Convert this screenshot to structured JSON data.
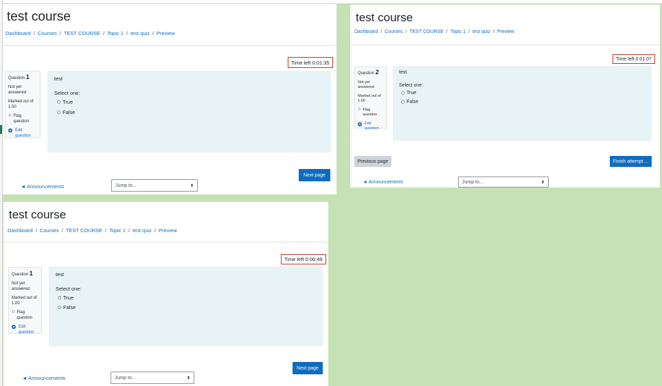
{
  "views": [
    {
      "course_title": "test course",
      "breadcrumb": [
        "Dashboard",
        "Courses",
        "TEST COURSE",
        "Topic 1",
        "test quiz",
        "Preview"
      ],
      "timer": "Time left 0:01:35",
      "question_label": "Question",
      "question_number": "1",
      "status": [
        "Not yet",
        "answered"
      ],
      "marks": [
        "Marked out of",
        "1.00"
      ],
      "flag_glyph": "⚐",
      "flag": [
        "Flag",
        "question"
      ],
      "edit": [
        "Edit",
        "question"
      ],
      "question_text": "test",
      "prompt": "Select one:",
      "options": [
        "True",
        "False"
      ],
      "next_button": "Next page",
      "announcements": "◄ Announcements",
      "jump_to": "Jump to...",
      "jump_arrows": "⬍"
    },
    {
      "course_title": "test course",
      "breadcrumb": [
        "Dashboard",
        "Courses",
        "TEST COURSE",
        "Topic 1",
        "test quiz",
        "Preview"
      ],
      "timer": "Time left 0:01:07",
      "question_label": "Question",
      "question_number": "2",
      "status": [
        "Not yet",
        "answered"
      ],
      "marks": [
        "Marked out of",
        "1.00"
      ],
      "flag_glyph": "⚐",
      "flag": [
        "Flag",
        "question"
      ],
      "edit": [
        "Edit",
        "question"
      ],
      "question_text": "test",
      "prompt": "Select one:",
      "options": [
        "True",
        "False"
      ],
      "previous_button": "Previous page",
      "finish_button": "Finish attempt ...",
      "announcements": "◄ Announcements",
      "jump_to": "Jump to...",
      "jump_arrows": "⬍"
    },
    {
      "course_title": "test course",
      "breadcrumb": [
        "Dashboard",
        "Courses",
        "TEST COURSE",
        "Topic 1",
        "test quiz",
        "Preview"
      ],
      "timer": "Time left 0:00:49",
      "question_label": "Question",
      "question_number": "1",
      "status": [
        "Not yet",
        "answered"
      ],
      "marks": [
        "Marked out of",
        "1.00"
      ],
      "flag_glyph": "⚐",
      "flag": [
        "Flag",
        "question"
      ],
      "edit": [
        "Edit",
        "question"
      ],
      "question_text": "test",
      "prompt": "Select one:",
      "options": [
        "True",
        "False"
      ],
      "next_button": "Next page",
      "announcements": "◄ Announcements",
      "jump_to": "Jump to...",
      "jump_arrows": "⬍"
    }
  ],
  "colors": {
    "background": "#c4e2b4",
    "link": "#0f6cbf",
    "primary_button": "#0f6cbf",
    "timer_border": "#ca3120",
    "question_bg": "#e7f3f5"
  }
}
